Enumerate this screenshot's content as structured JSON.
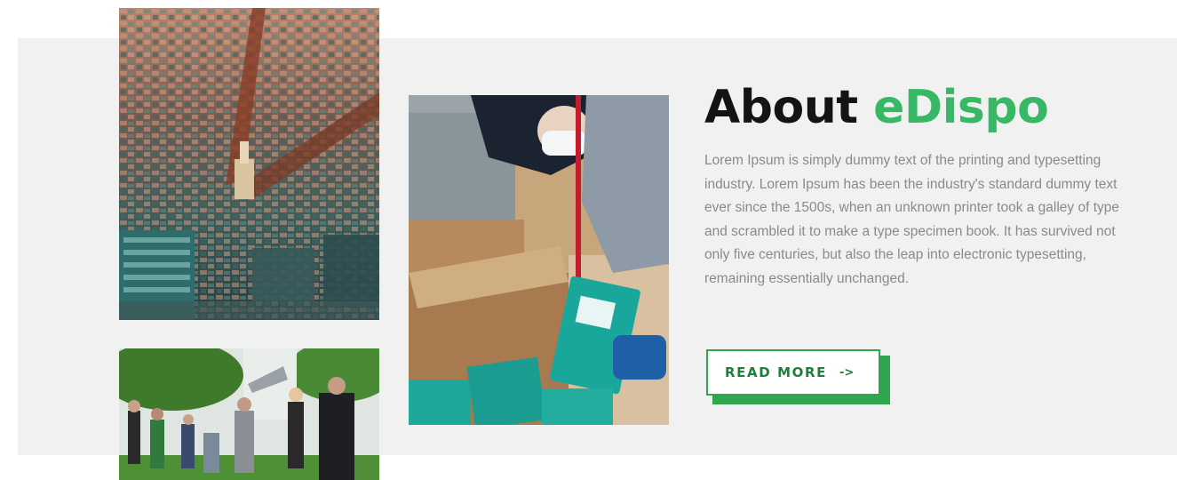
{
  "about": {
    "title_prefix": "About ",
    "title_brand": "eDispo",
    "body": "Lorem Ipsum is simply dummy text of the printing and typesetting industry. Lorem Ipsum has been the industry's standard dummy text ever since the 1500s, when an unknown printer took a galley of type and scrambled it to make a type specimen book. It has survived not only five centuries, but also the leap into electronic typesetting, remaining essentially unchanged.",
    "cta_label": "READ MORE",
    "cta_arrow": "->"
  },
  "colors": {
    "brand_green": "#37b864",
    "button_green": "#2fa64f",
    "band_background": "#f1f1f2",
    "title_text": "#141414",
    "body_text": "#8a8a8a"
  },
  "images": [
    {
      "id": "city",
      "alt": "aerial city view"
    },
    {
      "id": "boxes",
      "alt": "worker packing boxes"
    },
    {
      "id": "crowd",
      "alt": "group of people outdoors"
    }
  ]
}
